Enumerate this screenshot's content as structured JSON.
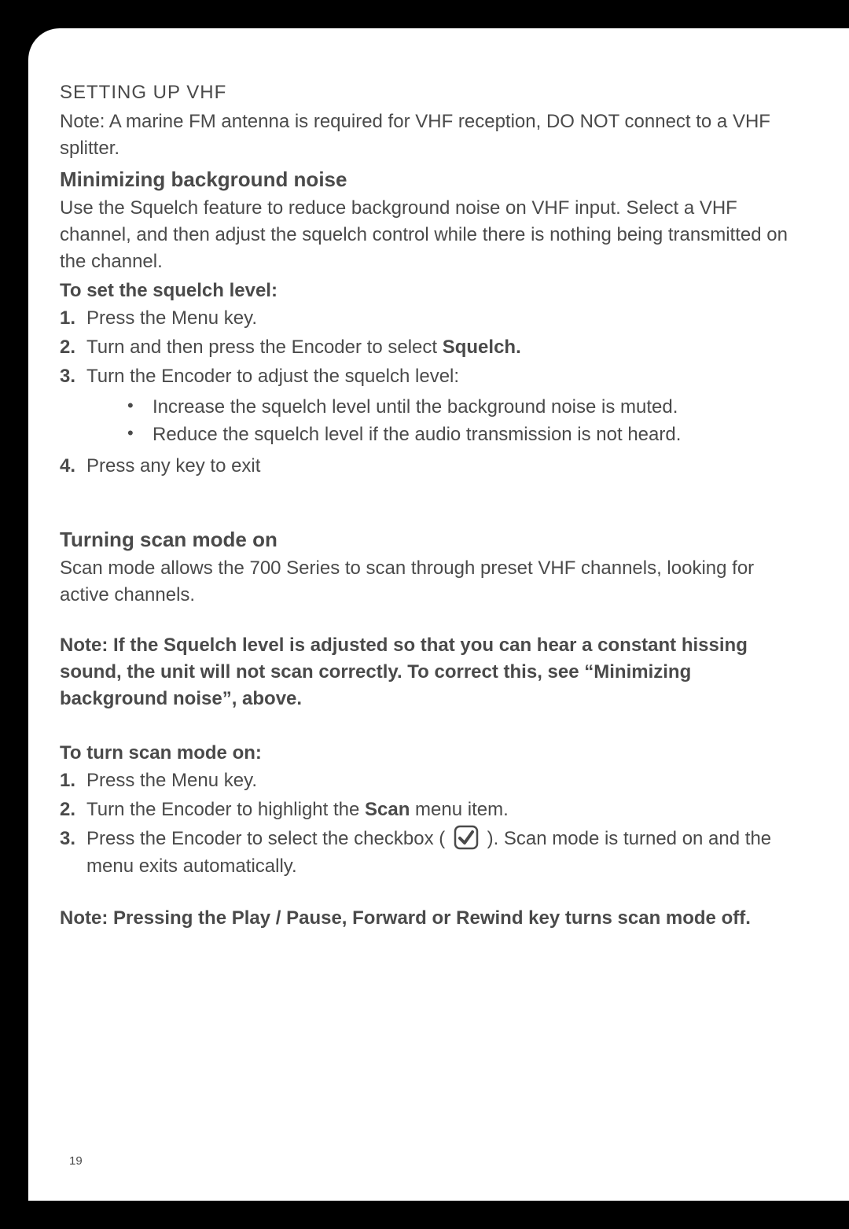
{
  "section_label": "SETTING UP VHF",
  "intro_note": "Note: A marine FM antenna is required for VHF reception, DO NOT connect to a VHF splitter.",
  "h1": "Minimizing background noise",
  "h1_body": "Use the Squelch feature to reduce background noise on VHF input. Select a VHF channel, and then adjust the squelch control while there is nothing being transmitted on the channel.",
  "squelch_sub": "To set the squelch level:",
  "squelch_steps": {
    "s1": "Press the Menu key.",
    "s2a": "Turn and then press the Encoder to select ",
    "s2b": "Squelch.",
    "s3": "Turn the Encoder to adjust the squelch level:",
    "s3_b1": "Increase the squelch level until the background noise is muted.",
    "s3_b2": "Reduce the squelch level if the audio transmission is not heard.",
    "s4": "Press any key to exit"
  },
  "h2": "Turning scan mode on",
  "h2_body": "Scan mode allows the 700 Series to scan through preset VHF channels, looking for active channels.",
  "scan_note": "Note: If the Squelch level is adjusted so that you can hear a constant hissing sound, the unit will not scan correctly. To correct this, see “Minimizing background noise”, above.",
  "scan_sub": "To turn scan mode on:",
  "scan_steps": {
    "s1": "Press the Menu key.",
    "s2a": "Turn the Encoder to highlight the ",
    "s2b": "Scan",
    "s2c": " menu item.",
    "s3a": "Press the Encoder to select the checkbox ( ",
    "s3b": " ). Scan mode is turned on and the menu exits automatically."
  },
  "scan_off_note": "Note: Pressing the Play / Pause, Forward or Rewind key turns scan mode off.",
  "page_number": "19",
  "nums": {
    "n1": "1.",
    "n2": "2.",
    "n3": "3.",
    "n4": "4."
  },
  "bullet": "•"
}
